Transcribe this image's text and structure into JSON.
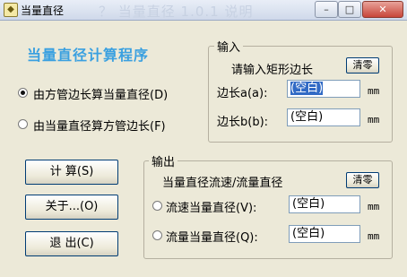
{
  "window": {
    "title": "当量直径",
    "background_ghost_text": "？ 当量直径 1.0.1 说明",
    "controls": {
      "minimize": "–",
      "maximize": "□",
      "close": "✕"
    }
  },
  "main": {
    "title": "当量直径计算程序",
    "title_color": "#3aa0e0",
    "mode_options": [
      {
        "label": "由方管边长算当量直径(D)",
        "checked": true
      },
      {
        "label": "由当量直径算方管边长(F)",
        "checked": false
      }
    ]
  },
  "input_group": {
    "title": "输入",
    "prompt": "请输入矩形边长",
    "clear_label": "清零",
    "side_a_label": "边长a(a):",
    "side_a_value": "(空白)",
    "side_b_label": "边长b(b):",
    "side_b_value": "(空白)",
    "unit": "mm"
  },
  "buttons": {
    "calculate": "计  算(S)",
    "about": "关于...(O)",
    "exit": "退  出(C)"
  },
  "output_group": {
    "title": "输出",
    "prompt": "当量直径流速/流量直径",
    "clear_label": "清零",
    "velocity_label": "流速当量直径(V):",
    "velocity_value": "(空白)",
    "flow_label": "流量当量直径(Q):",
    "flow_value": "(空白)",
    "unit": "mm"
  }
}
